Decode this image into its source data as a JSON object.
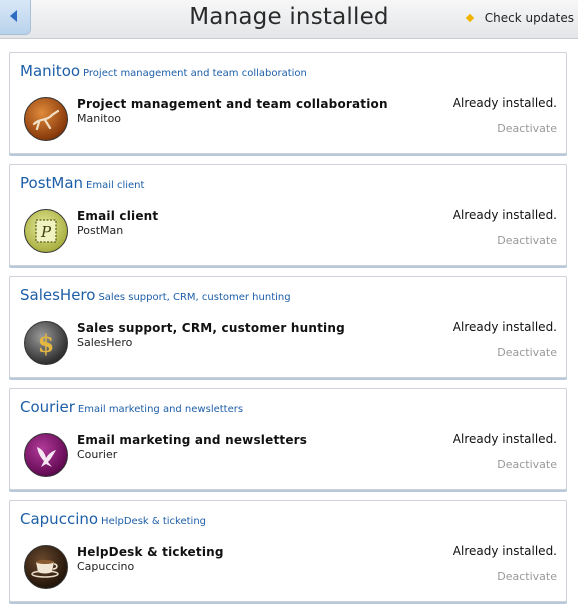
{
  "header": {
    "title": "Manage installed",
    "back_icon": "chevron-left-icon",
    "check_updates_label": "Check updates",
    "accent": "#f0b400"
  },
  "apps": [
    {
      "name": "Manitoo",
      "subtitle": "Project management and team collaboration",
      "description": "Project management and team collaboration",
      "short_name": "Manitoo",
      "status": "Already installed.",
      "action": "Deactivate",
      "icon": "manitoo-icon"
    },
    {
      "name": "PostMan",
      "subtitle": "Email client",
      "description": "Email client",
      "short_name": "PostMan",
      "status": "Already installed.",
      "action": "Deactivate",
      "icon": "postman-stamp-icon"
    },
    {
      "name": "SalesHero",
      "subtitle": "Sales support, CRM, customer hunting",
      "description": "Sales support, CRM, customer hunting",
      "short_name": "SalesHero",
      "status": "Already installed.",
      "action": "Deactivate",
      "icon": "saleshero-dollar-icon"
    },
    {
      "name": "Courier",
      "subtitle": "Email marketing and newsletters",
      "description": "Email marketing and newsletters",
      "short_name": "Courier",
      "status": "Already installed.",
      "action": "Deactivate",
      "icon": "courier-dove-icon"
    },
    {
      "name": "Capuccino",
      "subtitle": "HelpDesk & ticketing",
      "description": "HelpDesk & ticketing",
      "short_name": "Capuccino",
      "status": "Already installed.",
      "action": "Deactivate",
      "icon": "capuccino-cup-icon"
    }
  ],
  "colors": {
    "link_blue": "#1d5ea8",
    "muted": "#999999"
  }
}
